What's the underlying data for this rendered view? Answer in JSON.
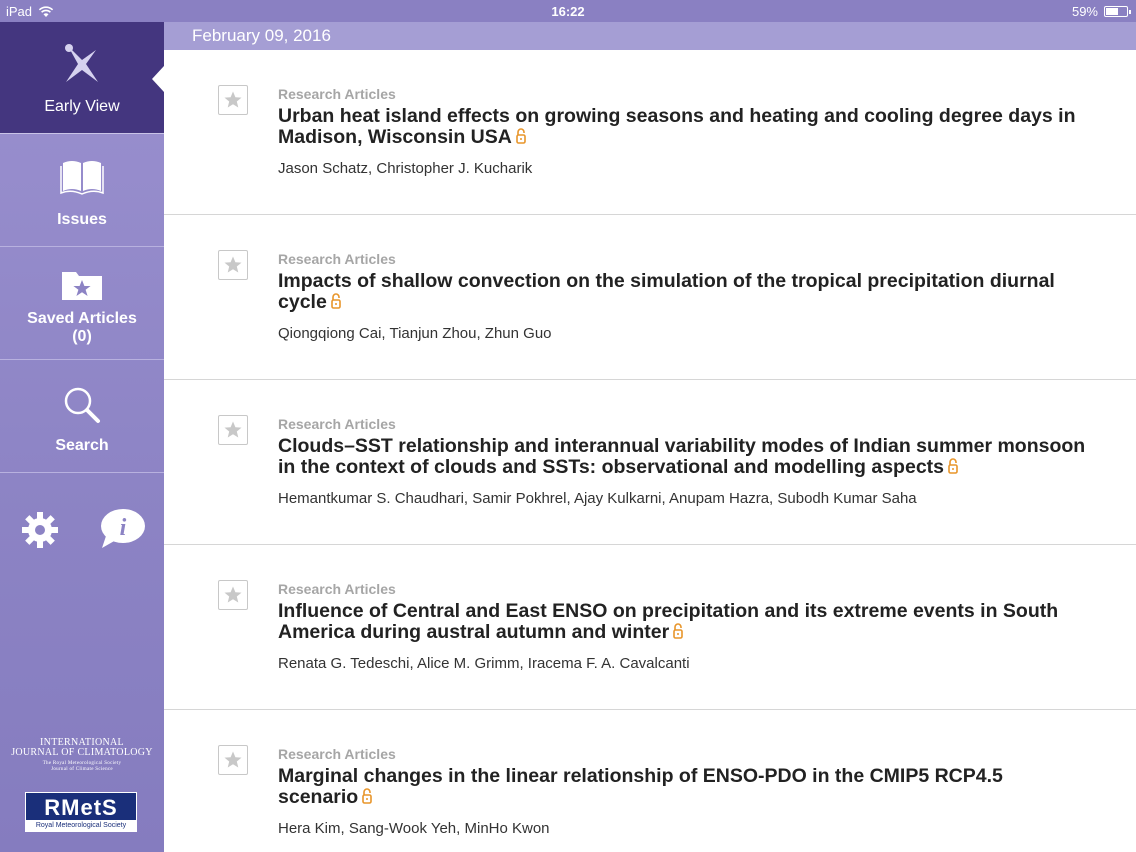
{
  "status_bar": {
    "device": "iPad",
    "time": "16:22",
    "battery": "59%",
    "battery_level": 0.59
  },
  "sidebar": {
    "items": [
      {
        "label": "Early View",
        "icon": "early-view-icon"
      },
      {
        "label": "Issues",
        "icon": "book-icon"
      },
      {
        "label": "Saved Articles",
        "count": "(0)",
        "icon": "folder-star-icon"
      },
      {
        "label": "Search",
        "icon": "magnifier-icon"
      }
    ],
    "tools": {
      "settings_icon": "gear-icon",
      "info_icon": "info-icon"
    },
    "journal": {
      "line1": "INTERNATIONAL",
      "line2": "JOURNAL OF CLIMATOLOGY",
      "line3": "The Royal Meteorological Society",
      "line4": "Journal of Climate Science"
    },
    "publisher": {
      "logo": "RMetS",
      "name": "Royal Meteorological Society"
    }
  },
  "date_header": "February 09, 2016",
  "articles": [
    {
      "category": "Research Articles",
      "title": "Urban heat island effects on growing seasons and heating and cooling degree days in Madison, Wisconsin USA",
      "authors": "Jason Schatz, Christopher J. Kucharik"
    },
    {
      "category": "Research Articles",
      "title": "Impacts of shallow convection on the simulation of the tropical precipitation diurnal cycle",
      "authors": "Qiongqiong Cai, Tianjun Zhou, Zhun Guo"
    },
    {
      "category": "Research Articles",
      "title": "Clouds–SST relationship and interannual variability modes of Indian summer monsoon in the context of clouds and SSTs: observational and modelling aspects",
      "authors": "Hemantkumar S. Chaudhari, Samir Pokhrel, Ajay Kulkarni, Anupam Hazra, Subodh Kumar Saha"
    },
    {
      "category": "Research Articles",
      "title": "Influence of Central and East ENSO on precipitation and its extreme events in South America during austral autumn and winter",
      "authors": "Renata G. Tedeschi, Alice M. Grimm, Iracema F. A. Cavalcanti"
    },
    {
      "category": "Research Articles",
      "title": "Marginal changes in the linear relationship of ENSO-PDO in the CMIP5 RCP4.5 scenario",
      "authors": "Hera Kim, Sang-Wook Yeh, MinHo Kwon"
    }
  ],
  "colors": {
    "sidebar": "#8c83c4",
    "sidebar_active": "#44367f",
    "date_bar": "#a59ed4",
    "lock": "#e8952a",
    "category": "#a6a6a6"
  }
}
